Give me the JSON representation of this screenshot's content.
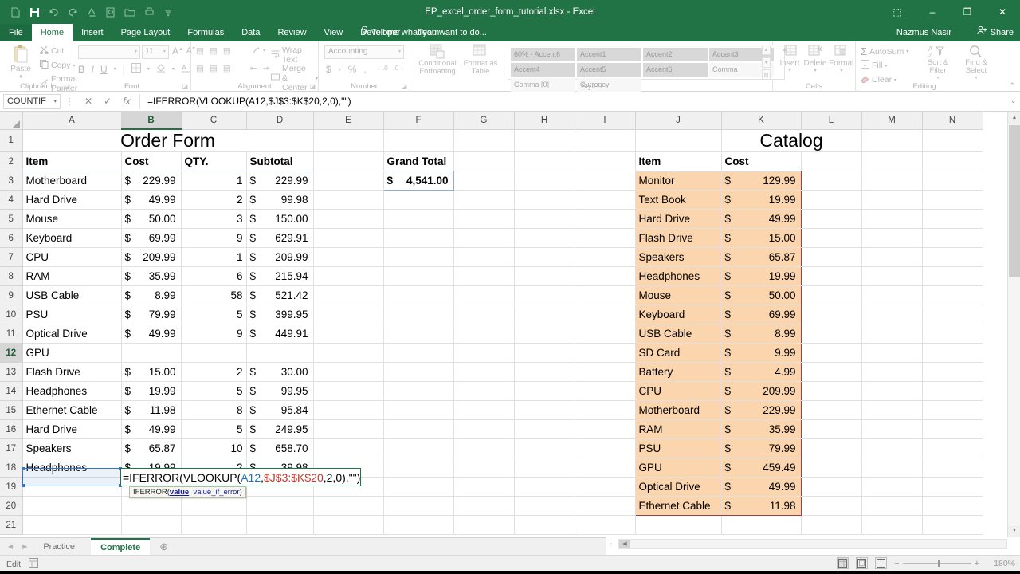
{
  "titlebar": {
    "document_title": "EP_excel_order_form_tutorial.xlsx - Excel",
    "quick_access": [
      {
        "name": "new-file",
        "glyph": "⬜"
      },
      {
        "name": "save",
        "glyph": "💾"
      },
      {
        "name": "undo",
        "glyph": "↶"
      },
      {
        "name": "redo",
        "glyph": "↷"
      },
      {
        "name": "spelling",
        "glyph": "✒"
      },
      {
        "name": "print-preview",
        "glyph": "🔍"
      },
      {
        "name": "open",
        "glyph": "📁"
      },
      {
        "name": "quick-print",
        "glyph": "🗋"
      },
      {
        "name": "customize",
        "glyph": "☰"
      }
    ],
    "window_controls": {
      "ribbon_display": "⬚",
      "minimize": "–",
      "restore": "❐",
      "close": "✕"
    }
  },
  "ribbon_tabs": {
    "file": "File",
    "items": [
      "Home",
      "Insert",
      "Page Layout",
      "Formulas",
      "Data",
      "Review",
      "View",
      "Developer",
      "Team"
    ],
    "active": "Home",
    "tell_me": "Tell me what you want to do...",
    "account_name": "Nazmus Nasir",
    "share_label": "Share"
  },
  "ribbon": {
    "clipboard": {
      "label": "Clipboard",
      "paste": "Paste",
      "cut": "Cut",
      "copy": "Copy",
      "format_painter": "Format Painter"
    },
    "font": {
      "label": "Font",
      "font_name": "",
      "font_size": "11",
      "grow": "A",
      "shrink": "A",
      "bold": "B",
      "italic": "I",
      "underline": "U",
      "borders": "▦",
      "fill_color": "◆",
      "font_color": "A"
    },
    "alignment": {
      "label": "Alignment",
      "wrap_text": "Wrap Text",
      "merge_center": "Merge & Center",
      "orientation": "↗"
    },
    "number": {
      "label": "Number",
      "format": "Accounting",
      "currency": "$",
      "percent": "%",
      "comma": ",",
      "increase_decimal": "⁺₀₀",
      "decrease_decimal": "₀₀⁻"
    },
    "styles": {
      "label": "Styles",
      "conditional_formatting": "Conditional Formatting",
      "format_as_table": "Format as Table",
      "gallery": [
        "60% - Accent6",
        "Accent1",
        "Accent2",
        "Accent3",
        "Accent4",
        "Accent5",
        "Accent6",
        "Comma",
        "Comma [0]",
        "Currency"
      ]
    },
    "cells": {
      "label": "Cells",
      "insert": "Insert",
      "delete": "Delete",
      "format": "Format"
    },
    "editing": {
      "label": "Editing",
      "autosum": "AutoSum",
      "fill": "Fill",
      "clear": "Clear",
      "sort_filter": "Sort & Filter",
      "find_select": "Find & Select"
    },
    "collapse": "⌃"
  },
  "formula_bar": {
    "name_box": "COUNTIF",
    "cancel": "✕",
    "enter": "✓",
    "insert_function": "fx",
    "formula": "=IFERROR(VLOOKUP(A12,$J$3:$K$20,2,0),\"\")",
    "expand": "⌄"
  },
  "grid": {
    "columns": [
      "A",
      "B",
      "C",
      "D",
      "E",
      "F",
      "G",
      "H",
      "I",
      "J",
      "K",
      "L",
      "M",
      "N"
    ],
    "active_column": "B",
    "active_row": "12",
    "rows": [
      "1",
      "2",
      "3",
      "4",
      "5",
      "6",
      "7",
      "8",
      "9",
      "10",
      "11",
      "12",
      "13",
      "14",
      "15",
      "16",
      "17",
      "18",
      "19",
      "20",
      "21"
    ]
  },
  "order_form": {
    "title": "Order Form",
    "headers": [
      "Item",
      "Cost",
      "QTY.",
      "Subtotal"
    ],
    "rows": [
      {
        "row": "3",
        "item": "Motherboard",
        "cost": "229.99",
        "qty": "1",
        "subtotal": "229.99"
      },
      {
        "row": "4",
        "item": "Hard Drive",
        "cost": "49.99",
        "qty": "2",
        "subtotal": "99.98"
      },
      {
        "row": "5",
        "item": "Mouse",
        "cost": "50.00",
        "qty": "3",
        "subtotal": "150.00"
      },
      {
        "row": "6",
        "item": "Keyboard",
        "cost": "69.99",
        "qty": "9",
        "subtotal": "629.91"
      },
      {
        "row": "7",
        "item": "CPU",
        "cost": "209.99",
        "qty": "1",
        "subtotal": "209.99"
      },
      {
        "row": "8",
        "item": "RAM",
        "cost": "35.99",
        "qty": "6",
        "subtotal": "215.94"
      },
      {
        "row": "9",
        "item": "USB Cable",
        "cost": "8.99",
        "qty": "58",
        "subtotal": "521.42"
      },
      {
        "row": "10",
        "item": "PSU",
        "cost": "79.99",
        "qty": "5",
        "subtotal": "399.95"
      },
      {
        "row": "11",
        "item": "Optical Drive",
        "cost": "49.99",
        "qty": "9",
        "subtotal": "449.91"
      },
      {
        "row": "12",
        "item": "GPU",
        "cost": "",
        "qty": "",
        "subtotal": ""
      },
      {
        "row": "13",
        "item": "Flash Drive",
        "cost": "15.00",
        "qty": "2",
        "subtotal": "30.00"
      },
      {
        "row": "14",
        "item": "Headphones",
        "cost": "19.99",
        "qty": "5",
        "subtotal": "99.95"
      },
      {
        "row": "15",
        "item": "Ethernet Cable",
        "cost": "11.98",
        "qty": "8",
        "subtotal": "95.84"
      },
      {
        "row": "16",
        "item": "Hard Drive",
        "cost": "49.99",
        "qty": "5",
        "subtotal": "249.95"
      },
      {
        "row": "17",
        "item": "Speakers",
        "cost": "65.87",
        "qty": "10",
        "subtotal": "658.70"
      },
      {
        "row": "18",
        "item": "Headphones",
        "cost": "19.99",
        "qty": "2",
        "subtotal": "39.98"
      }
    ]
  },
  "grand_total": {
    "label": "Grand Total",
    "currency": "$",
    "value": "4,541.00"
  },
  "catalog": {
    "title": "Catalog",
    "headers": [
      "Item",
      "Cost"
    ],
    "fill_color": "#fbd5ae",
    "border_color": "#a23d3d",
    "rows": [
      {
        "row": "3",
        "item": "Monitor",
        "cost": "129.99"
      },
      {
        "row": "4",
        "item": "Text Book",
        "cost": "19.99"
      },
      {
        "row": "5",
        "item": "Hard Drive",
        "cost": "49.99"
      },
      {
        "row": "6",
        "item": "Flash Drive",
        "cost": "15.00"
      },
      {
        "row": "7",
        "item": "Speakers",
        "cost": "65.87"
      },
      {
        "row": "8",
        "item": "Headphones",
        "cost": "19.99"
      },
      {
        "row": "9",
        "item": "Mouse",
        "cost": "50.00"
      },
      {
        "row": "10",
        "item": "Keyboard",
        "cost": "69.99"
      },
      {
        "row": "11",
        "item": "USB Cable",
        "cost": "8.99"
      },
      {
        "row": "12",
        "item": "SD Card",
        "cost": "9.99"
      },
      {
        "row": "13",
        "item": "Battery",
        "cost": "4.99"
      },
      {
        "row": "14",
        "item": "CPU",
        "cost": "209.99"
      },
      {
        "row": "15",
        "item": "Motherboard",
        "cost": "229.99"
      },
      {
        "row": "16",
        "item": "RAM",
        "cost": "35.99"
      },
      {
        "row": "17",
        "item": "PSU",
        "cost": "79.99"
      },
      {
        "row": "18",
        "item": "GPU",
        "cost": "459.49"
      },
      {
        "row": "19",
        "item": "Optical Drive",
        "cost": "49.99"
      },
      {
        "row": "20",
        "item": "Ethernet Cable",
        "cost": "11.98"
      }
    ]
  },
  "cell_editor": {
    "cell": "B12",
    "prefix": "=IFERROR(VLOOKUP(",
    "ref1": "A12",
    "comma1": ",",
    "ref2": "$J$3:$K$20",
    "suffix": ",2,0),\"\")",
    "tooltip_function": "IFERROR",
    "tooltip_open": "(",
    "tooltip_arg1": "value",
    "tooltip_sep": ", ",
    "tooltip_arg2": "value_if_error",
    "tooltip_close": ")"
  },
  "sheet_tabs": {
    "prev": "◀",
    "next": "▶",
    "tabs": [
      "Practice",
      "Complete"
    ],
    "active": "Complete",
    "add": "⊕"
  },
  "status_bar": {
    "mode": "Edit",
    "accessibility": "▤",
    "views": [
      "▦",
      "▣",
      "▥"
    ],
    "active_view": "▦",
    "zoom_out": "−",
    "zoom_in": "+",
    "zoom_level": "180%"
  },
  "colors": {
    "excel_green": "#217346",
    "header_blue": "#1f3864",
    "title_slate": "#44546a",
    "catalog_fill": "#fbd5ae",
    "catalog_border": "#a23d3d",
    "formula_ref_blue": "#1f6fc4",
    "formula_ref_red": "#c0392b"
  }
}
